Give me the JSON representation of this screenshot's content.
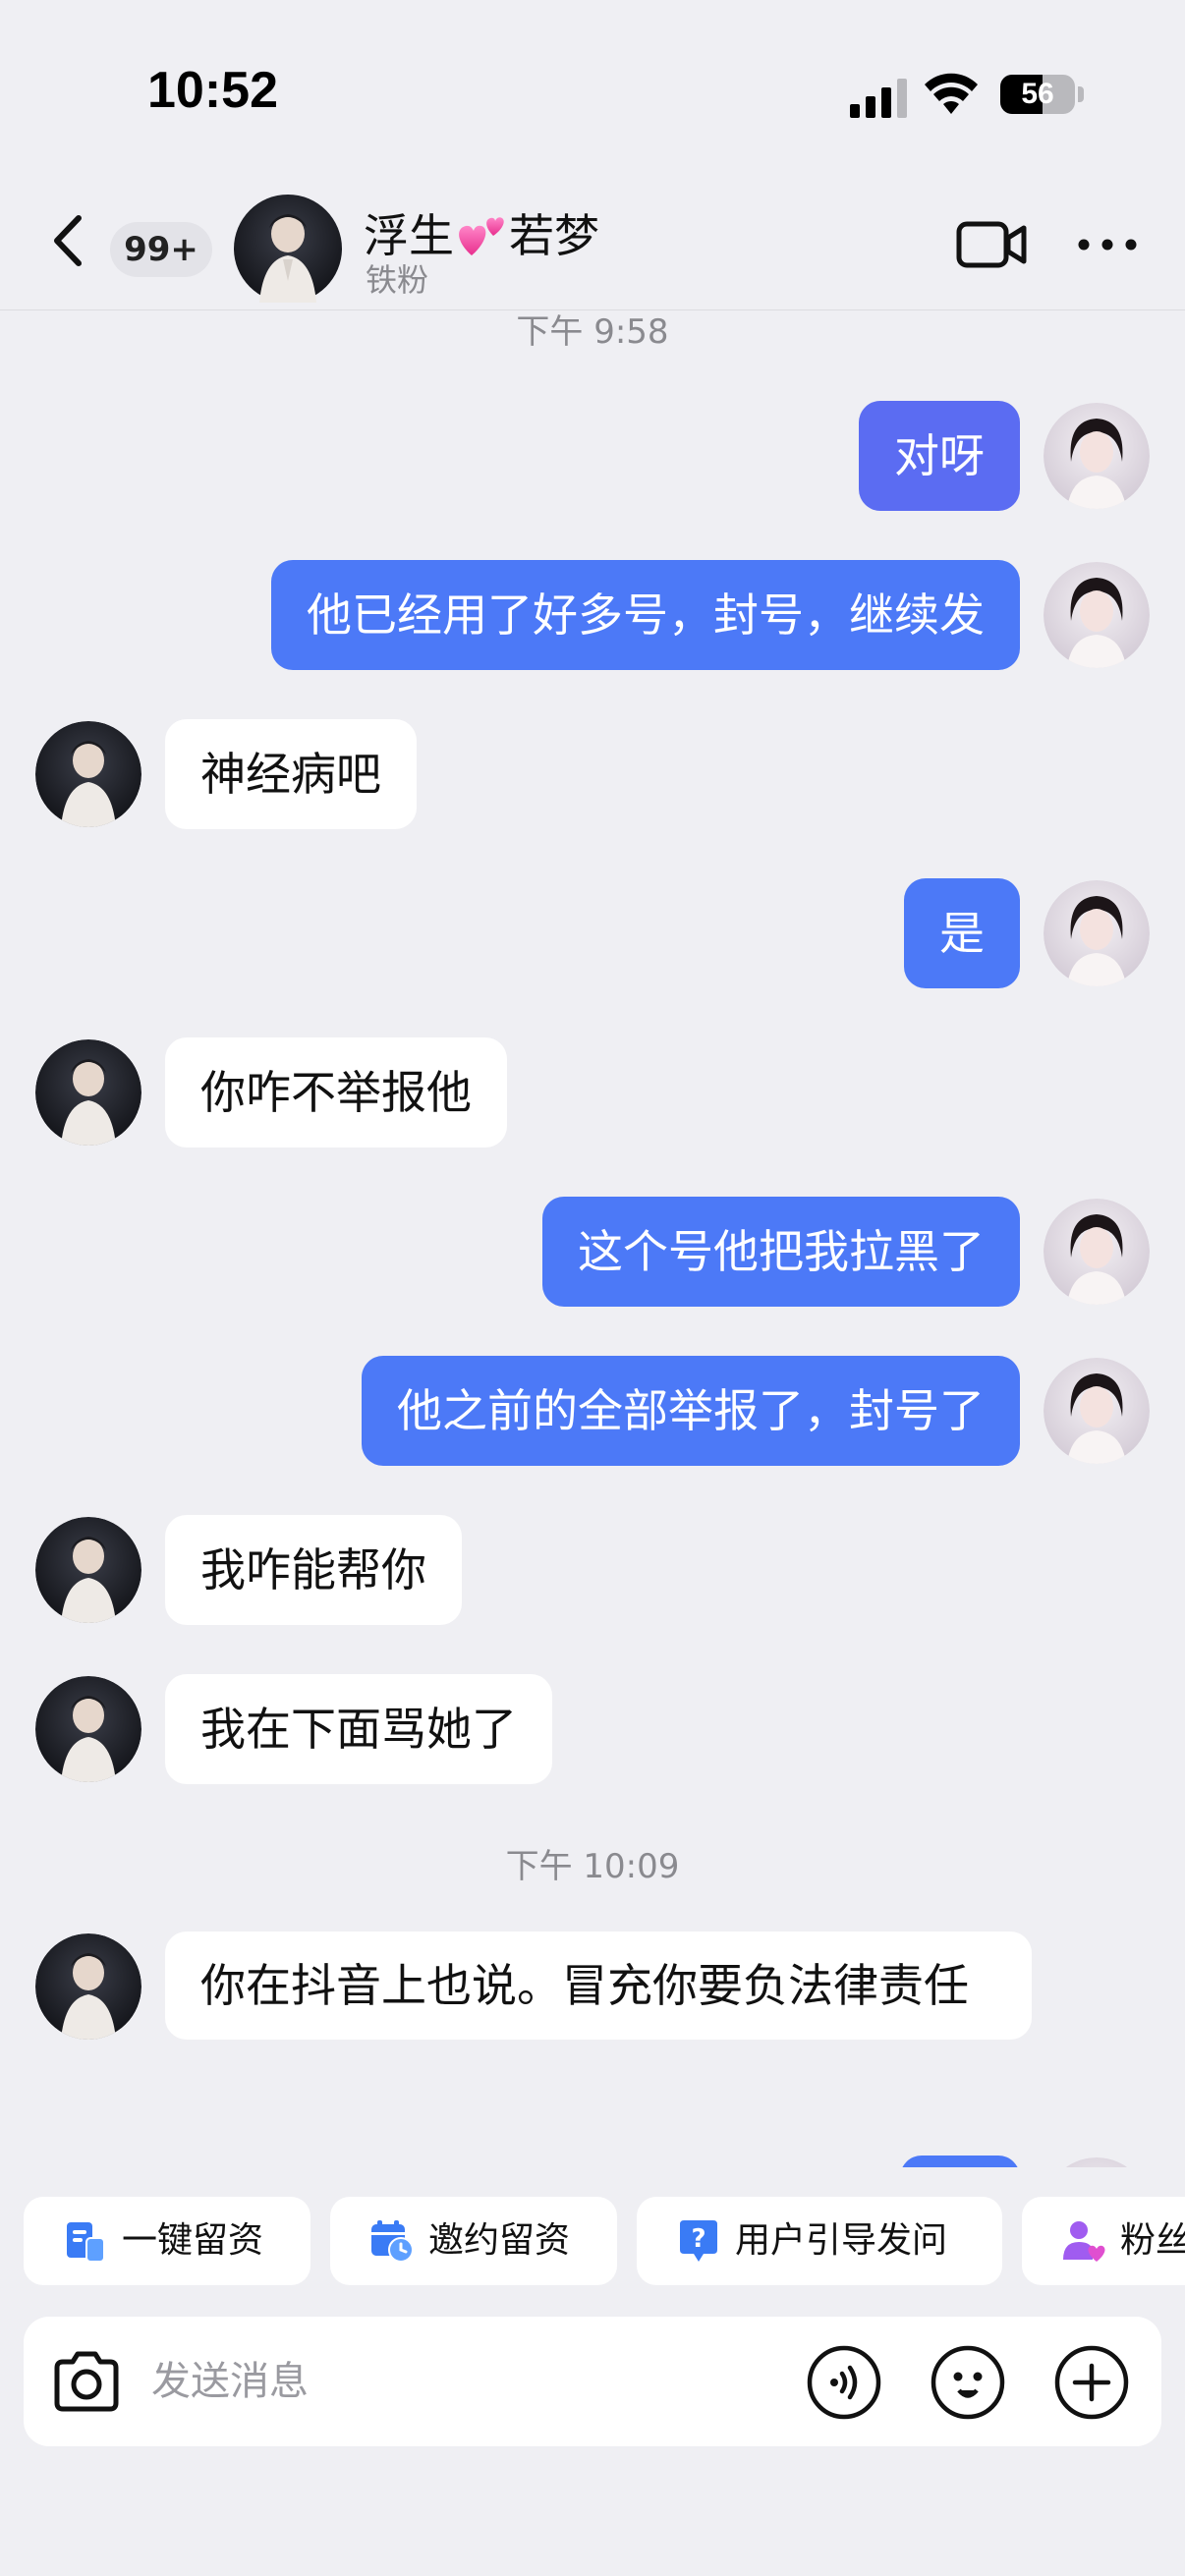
{
  "status_bar": {
    "time": "10:52",
    "battery": "56",
    "battery_level": 0.56
  },
  "header": {
    "unread_count": "99+",
    "contact_name_part1": "浮生",
    "contact_name_part2": "若梦",
    "contact_subtitle": "铁粉"
  },
  "timestamps": [
    "下午 9:58",
    "下午 10:09"
  ],
  "messages": [
    {
      "side": "out",
      "text": "对呀"
    },
    {
      "side": "out",
      "text": "他已经用了好多号，封号，继续发"
    },
    {
      "side": "in",
      "text": "神经病吧"
    },
    {
      "side": "out",
      "text": "是"
    },
    {
      "side": "in",
      "text": "你咋不举报他"
    },
    {
      "side": "out",
      "text": "这个号他把我拉黑了"
    },
    {
      "side": "out",
      "text": "他之前的全部举报了，封号了"
    },
    {
      "side": "in",
      "text": "我咋能帮你"
    },
    {
      "side": "in",
      "text": "我在下面骂她了"
    },
    {
      "side": "in",
      "text": "你在抖音上也说。冒充你要负法律责任"
    }
  ],
  "quick_replies": [
    "一键留资",
    "邀约留资",
    "用户引导发问",
    "粉丝"
  ],
  "input": {
    "placeholder": "发送消息"
  },
  "colors": {
    "outgoing_bubble": "#4c79f7",
    "incoming_bubble": "#ffffff",
    "background": "#efeff3"
  }
}
